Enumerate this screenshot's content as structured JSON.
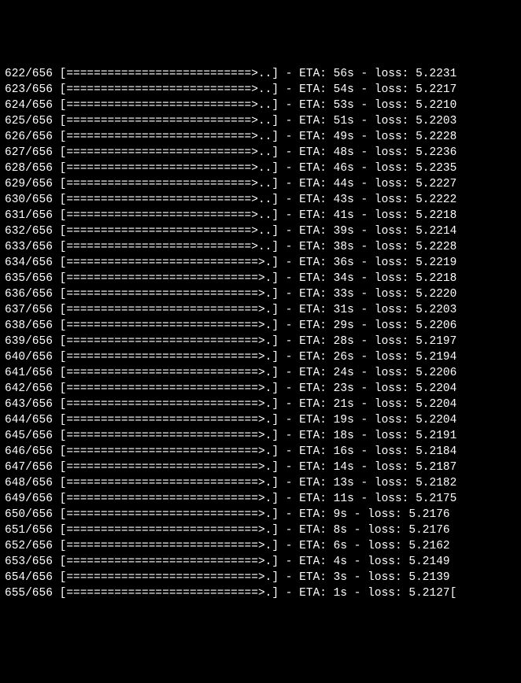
{
  "total": 656,
  "rows": [
    {
      "step": 622,
      "bar": "[===========================>..]",
      "eta": "56s",
      "loss": "5.2231"
    },
    {
      "step": 623,
      "bar": "[===========================>..]",
      "eta": "54s",
      "loss": "5.2217"
    },
    {
      "step": 624,
      "bar": "[===========================>..]",
      "eta": "53s",
      "loss": "5.2210"
    },
    {
      "step": 625,
      "bar": "[===========================>..]",
      "eta": "51s",
      "loss": "5.2203"
    },
    {
      "step": 626,
      "bar": "[===========================>..]",
      "eta": "49s",
      "loss": "5.2228"
    },
    {
      "step": 627,
      "bar": "[===========================>..]",
      "eta": "48s",
      "loss": "5.2236"
    },
    {
      "step": 628,
      "bar": "[===========================>..]",
      "eta": "46s",
      "loss": "5.2235"
    },
    {
      "step": 629,
      "bar": "[===========================>..]",
      "eta": "44s",
      "loss": "5.2227"
    },
    {
      "step": 630,
      "bar": "[===========================>..]",
      "eta": "43s",
      "loss": "5.2222"
    },
    {
      "step": 631,
      "bar": "[===========================>..]",
      "eta": "41s",
      "loss": "5.2218"
    },
    {
      "step": 632,
      "bar": "[===========================>..]",
      "eta": "39s",
      "loss": "5.2214"
    },
    {
      "step": 633,
      "bar": "[===========================>..]",
      "eta": "38s",
      "loss": "5.2228"
    },
    {
      "step": 634,
      "bar": "[============================>.]",
      "eta": "36s",
      "loss": "5.2219"
    },
    {
      "step": 635,
      "bar": "[============================>.]",
      "eta": "34s",
      "loss": "5.2218"
    },
    {
      "step": 636,
      "bar": "[============================>.]",
      "eta": "33s",
      "loss": "5.2220"
    },
    {
      "step": 637,
      "bar": "[============================>.]",
      "eta": "31s",
      "loss": "5.2203"
    },
    {
      "step": 638,
      "bar": "[============================>.]",
      "eta": "29s",
      "loss": "5.2206"
    },
    {
      "step": 639,
      "bar": "[============================>.]",
      "eta": "28s",
      "loss": "5.2197"
    },
    {
      "step": 640,
      "bar": "[============================>.]",
      "eta": "26s",
      "loss": "5.2194"
    },
    {
      "step": 641,
      "bar": "[============================>.]",
      "eta": "24s",
      "loss": "5.2206"
    },
    {
      "step": 642,
      "bar": "[============================>.]",
      "eta": "23s",
      "loss": "5.2204"
    },
    {
      "step": 643,
      "bar": "[============================>.]",
      "eta": "21s",
      "loss": "5.2204"
    },
    {
      "step": 644,
      "bar": "[============================>.]",
      "eta": "19s",
      "loss": "5.2204"
    },
    {
      "step": 645,
      "bar": "[============================>.]",
      "eta": "18s",
      "loss": "5.2191"
    },
    {
      "step": 646,
      "bar": "[============================>.]",
      "eta": "16s",
      "loss": "5.2184"
    },
    {
      "step": 647,
      "bar": "[============================>.]",
      "eta": "14s",
      "loss": "5.2187"
    },
    {
      "step": 648,
      "bar": "[============================>.]",
      "eta": "13s",
      "loss": "5.2182"
    },
    {
      "step": 649,
      "bar": "[============================>.]",
      "eta": "11s",
      "loss": "5.2175"
    },
    {
      "step": 650,
      "bar": "[============================>.]",
      "eta": "9s",
      "loss": "5.2176"
    },
    {
      "step": 651,
      "bar": "[============================>.]",
      "eta": "8s",
      "loss": "5.2176"
    },
    {
      "step": 652,
      "bar": "[============================>.]",
      "eta": "6s",
      "loss": "5.2162"
    },
    {
      "step": 653,
      "bar": "[============================>.]",
      "eta": "4s",
      "loss": "5.2149"
    },
    {
      "step": 654,
      "bar": "[============================>.]",
      "eta": "3s",
      "loss": "5.2139"
    },
    {
      "step": 655,
      "bar": "[============================>.]",
      "eta": "1s",
      "loss": "5.2127",
      "cursor": true
    }
  ],
  "labels": {
    "eta_prefix": "ETA:",
    "loss_prefix": "loss:",
    "sep": " - "
  }
}
